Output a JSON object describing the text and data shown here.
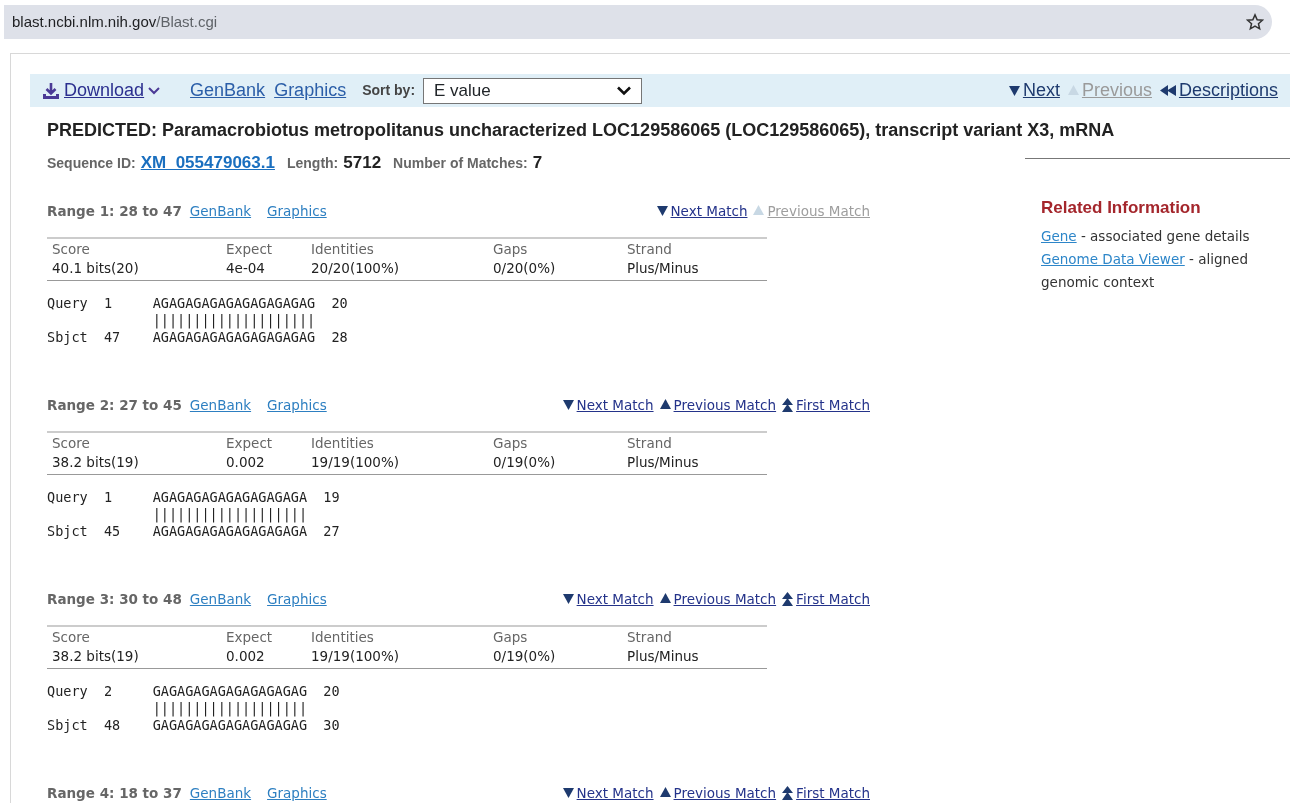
{
  "address_bar": {
    "host": "blast.ncbi.nlm.nih.gov",
    "path": "/Blast.cgi"
  },
  "toolbar": {
    "download": "Download",
    "links": [
      "GenBank",
      "Graphics"
    ],
    "sort_label": "Sort by:",
    "sort_value": "E value",
    "nav": [
      {
        "kind": "next",
        "label": "Next",
        "disabled": false
      },
      {
        "kind": "previous",
        "label": "Previous",
        "disabled": true
      },
      {
        "kind": "descriptions",
        "label": "Descriptions",
        "disabled": false
      }
    ]
  },
  "title": "PREDICTED: Paramacrobiotus metropolitanus uncharacterized LOC129586065 (LOC129586065), transcript variant X3, mRNA",
  "meta": [
    {
      "label": "Sequence ID:",
      "value": "XM_055479063.1",
      "kind": "link"
    },
    {
      "label": "Length:",
      "value": "5712",
      "kind": "text"
    },
    {
      "label": "Number of Matches:",
      "value": "7",
      "kind": "text"
    }
  ],
  "related": {
    "heading": "Related Information",
    "items": [
      {
        "link": "Gene",
        "text": "- associated gene details"
      },
      {
        "link": "Genome Data Viewer",
        "text": "- aligned genomic context"
      }
    ]
  },
  "ranges": [
    {
      "heading": "Range 1: 28 to 47",
      "links": [
        "GenBank",
        "Graphics"
      ],
      "nav": [
        {
          "kind": "next",
          "label": "Next Match",
          "disabled": false
        },
        {
          "kind": "previous",
          "label": "Previous Match",
          "disabled": true
        }
      ],
      "columns": [
        "Score",
        "Expect",
        "Identities",
        "Gaps",
        "Strand"
      ],
      "values": [
        "40.1 bits(20)",
        "4e-04",
        "20/20(100%)",
        "0/20(0%)",
        "Plus/Minus"
      ],
      "query": {
        "label": "Query",
        "start": "1",
        "seq": "AGAGAGAGAGAGAGAGAGAG",
        "end": "20"
      },
      "midline": "||||||||||||||||||||",
      "sbjct": {
        "label": "Sbjct",
        "start": "47",
        "seq": "AGAGAGAGAGAGAGAGAGAG",
        "end": "28"
      }
    },
    {
      "heading": "Range 2: 27 to 45",
      "links": [
        "GenBank",
        "Graphics"
      ],
      "nav": [
        {
          "kind": "next",
          "label": "Next Match",
          "disabled": false
        },
        {
          "kind": "previous",
          "label": "Previous Match",
          "disabled": false
        },
        {
          "kind": "first",
          "label": "First Match",
          "disabled": false
        }
      ],
      "columns": [
        "Score",
        "Expect",
        "Identities",
        "Gaps",
        "Strand"
      ],
      "values": [
        "38.2 bits(19)",
        "0.002",
        "19/19(100%)",
        "0/19(0%)",
        "Plus/Minus"
      ],
      "query": {
        "label": "Query",
        "start": "1",
        "seq": "AGAGAGAGAGAGAGAGAGA",
        "end": "19"
      },
      "midline": "|||||||||||||||||||",
      "sbjct": {
        "label": "Sbjct",
        "start": "45",
        "seq": "AGAGAGAGAGAGAGAGAGA",
        "end": "27"
      }
    },
    {
      "heading": "Range 3: 30 to 48",
      "links": [
        "GenBank",
        "Graphics"
      ],
      "nav": [
        {
          "kind": "next",
          "label": "Next Match",
          "disabled": false
        },
        {
          "kind": "previous",
          "label": "Previous Match",
          "disabled": false
        },
        {
          "kind": "first",
          "label": "First Match",
          "disabled": false
        }
      ],
      "columns": [
        "Score",
        "Expect",
        "Identities",
        "Gaps",
        "Strand"
      ],
      "values": [
        "38.2 bits(19)",
        "0.002",
        "19/19(100%)",
        "0/19(0%)",
        "Plus/Minus"
      ],
      "query": {
        "label": "Query",
        "start": "2",
        "seq": "GAGAGAGAGAGAGAGAGAG",
        "end": "20"
      },
      "midline": "|||||||||||||||||||",
      "sbjct": {
        "label": "Sbjct",
        "start": "48",
        "seq": "GAGAGAGAGAGAGAGAGAG",
        "end": "30"
      }
    },
    {
      "heading": "Range 4: 18 to 37",
      "links": [
        "GenBank",
        "Graphics"
      ],
      "nav": [
        {
          "kind": "next",
          "label": "Next Match",
          "disabled": false
        },
        {
          "kind": "previous",
          "label": "Previous Match",
          "disabled": false
        },
        {
          "kind": "first",
          "label": "First Match",
          "disabled": false
        }
      ]
    }
  ]
}
